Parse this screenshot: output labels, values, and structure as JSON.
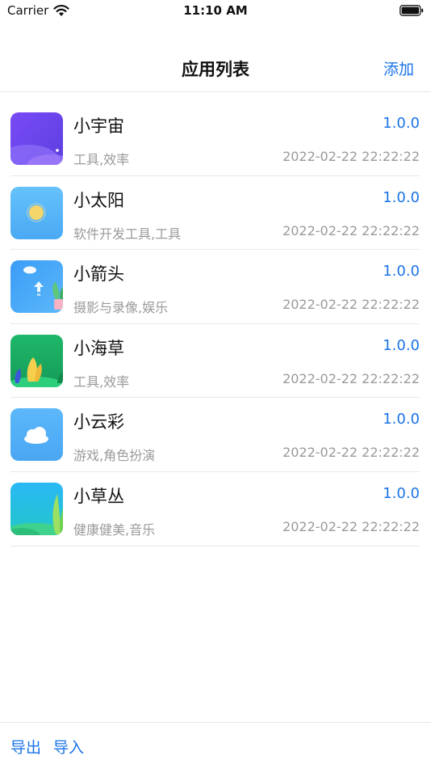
{
  "status_bar": {
    "carrier": "Carrier",
    "time": "11:10 AM"
  },
  "nav": {
    "title": "应用列表",
    "add_label": "添加"
  },
  "apps": [
    {
      "name": "小宇宙",
      "version": "1.0.0",
      "tags": "工具,效率",
      "date": "2022-02-22 22:22:22",
      "icon": "purple-planet-icon"
    },
    {
      "name": "小太阳",
      "version": "1.0.0",
      "tags": "软件开发工具,工具",
      "date": "2022-02-22 22:22:22",
      "icon": "sun-icon"
    },
    {
      "name": "小箭头",
      "version": "1.0.0",
      "tags": "摄影与录像,娱乐",
      "date": "2022-02-22 22:22:22",
      "icon": "upload-arrow-icon"
    },
    {
      "name": "小海草",
      "version": "1.0.0",
      "tags": "工具,效率",
      "date": "2022-02-22 22:22:22",
      "icon": "green-plants-icon"
    },
    {
      "name": "小云彩",
      "version": "1.0.0",
      "tags": "游戏,角色扮演",
      "date": "2022-02-22 22:22:22",
      "icon": "cloud-icon"
    },
    {
      "name": "小草丛",
      "version": "1.0.0",
      "tags": "健康健美,音乐",
      "date": "2022-02-22 22:22:22",
      "icon": "grass-leaves-icon"
    }
  ],
  "toolbar": {
    "export_label": "导出",
    "import_label": "导入"
  },
  "colors": {
    "accent": "#1a73e8",
    "secondary_text": "#9a9a9a"
  }
}
